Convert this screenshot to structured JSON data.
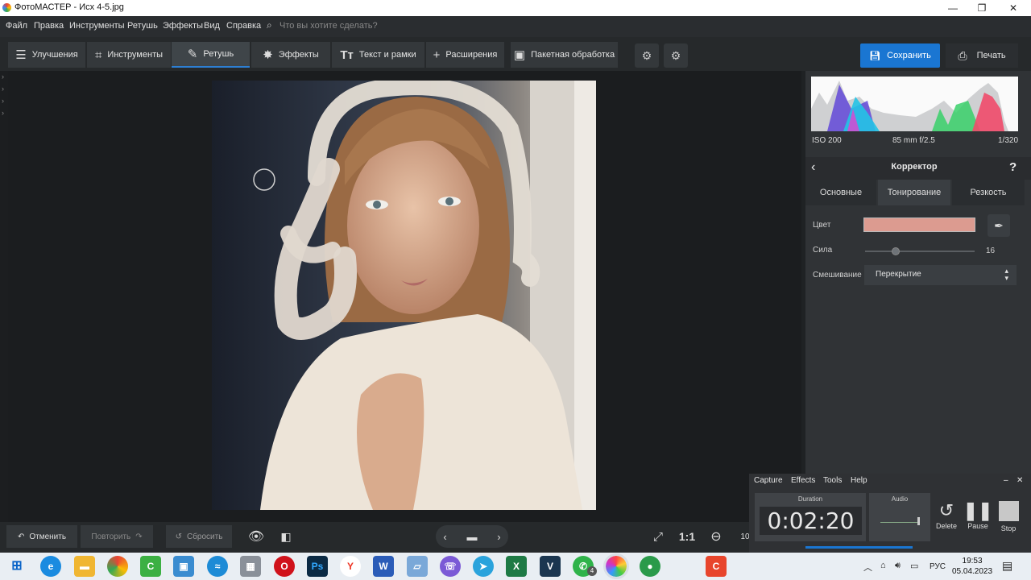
{
  "window": {
    "title": "ФотоМАСТЕР - Исх 4-5.jpg"
  },
  "menu": {
    "items": [
      "Файл",
      "Правка",
      "Инструменты",
      "Ретушь",
      "Эффекты",
      "Вид",
      "Справка"
    ],
    "search_placeholder": "Что вы хотите сделать?"
  },
  "tabs": [
    {
      "label": "Улучшения",
      "icon": "sliders-icon"
    },
    {
      "label": "Инструменты",
      "icon": "crop-icon"
    },
    {
      "label": "Ретушь",
      "icon": "brush-icon",
      "active": true
    },
    {
      "label": "Эффекты",
      "icon": "sparkle-icon"
    },
    {
      "label": "Текст и рамки",
      "icon": "text-icon"
    },
    {
      "label": "Расширения",
      "icon": "plus-icon"
    },
    {
      "label": "Пакетная обработка",
      "icon": "batch-icon"
    }
  ],
  "actions": {
    "save": "Сохранить",
    "print": "Печать"
  },
  "exif": {
    "iso": "ISO 200",
    "lens": "85 mm f/2.5",
    "shutter": "1/320"
  },
  "panel": {
    "title": "Корректор",
    "help": "?",
    "tabs": [
      "Основные",
      "Тонирование",
      "Резкость"
    ],
    "active_tab": "Тонирование",
    "color_label": "Цвет",
    "color_value": "#dc9b90",
    "strength_label": "Сила",
    "strength_value": "16",
    "blend_label": "Смешивание",
    "blend_value": "Перекрытие"
  },
  "bottom": {
    "undo": "Отменить",
    "redo": "Повторить",
    "reset": "Сбросить",
    "zoom_1to1": "1:1",
    "zoom_value": "10"
  },
  "capture": {
    "menu": [
      "Capture",
      "Effects",
      "Tools",
      "Help"
    ],
    "duration_label": "Duration",
    "duration": "0:02:20",
    "audio_label": "Audio",
    "delete": "Delete",
    "pause": "Pause",
    "stop": "Stop"
  },
  "taskbar": {
    "lang": "РУС",
    "time": "19:53",
    "date": "05.04.2023",
    "whatsapp_badge": "4"
  }
}
